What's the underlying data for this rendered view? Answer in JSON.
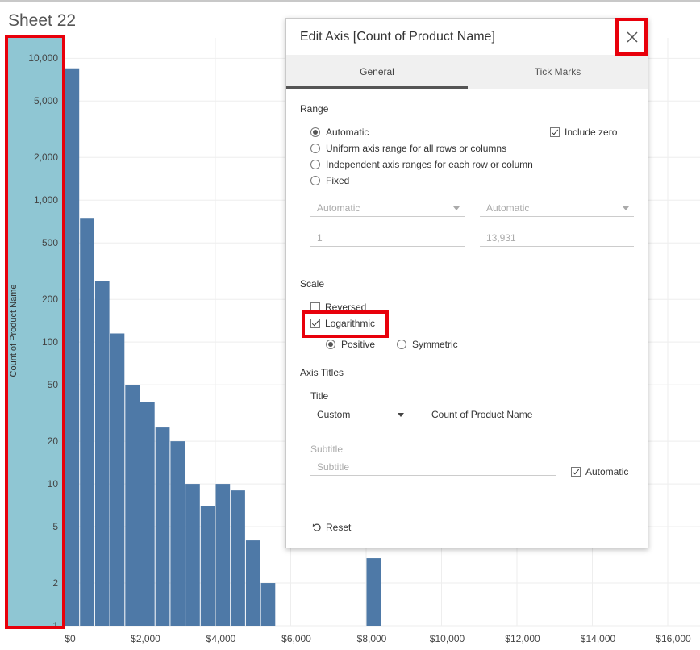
{
  "sheet_title": "Sheet 22",
  "chart_data": {
    "type": "bar",
    "ylabel": "Count of Product Name",
    "y_scale": "log",
    "y_ticks": [
      "10,000",
      "5,000",
      "2,000",
      "1,000",
      "500",
      "200",
      "100",
      "50",
      "20",
      "10",
      "5",
      "2",
      "1"
    ],
    "x_ticks": [
      "$0",
      "$2,000",
      "$4,000",
      "$6,000",
      "$8,000",
      "$10,000",
      "$12,000",
      "$14,000",
      "$16,000"
    ],
    "bin_width": 400,
    "bins": [
      {
        "x": 0,
        "value": 8500
      },
      {
        "x": 400,
        "value": 750
      },
      {
        "x": 800,
        "value": 270
      },
      {
        "x": 1200,
        "value": 115
      },
      {
        "x": 1600,
        "value": 50
      },
      {
        "x": 2000,
        "value": 38
      },
      {
        "x": 2400,
        "value": 25
      },
      {
        "x": 2800,
        "value": 20
      },
      {
        "x": 3200,
        "value": 10
      },
      {
        "x": 3600,
        "value": 7
      },
      {
        "x": 4000,
        "value": 10
      },
      {
        "x": 4400,
        "value": 9
      },
      {
        "x": 4800,
        "value": 4
      },
      {
        "x": 5200,
        "value": 2
      },
      {
        "x": 8000,
        "value": 3
      }
    ],
    "bar_color": "#4e79a7",
    "axis_pane_color": "#8fc6d3",
    "highlight_color": "#e8000b"
  },
  "dialog": {
    "title": "Edit Axis [Count of Product Name]",
    "close_icon": "close-icon",
    "tabs": [
      "General",
      "Tick Marks"
    ],
    "active_tab": "General",
    "range": {
      "label": "Range",
      "options": [
        "Automatic",
        "Uniform axis range for all rows or columns",
        "Independent axis ranges for each row or column",
        "Fixed"
      ],
      "selected": "Automatic",
      "include_zero_label": "Include zero",
      "include_zero": true,
      "start_select": "Automatic",
      "end_select": "Automatic",
      "start_value": "1",
      "end_value": "13,931"
    },
    "scale": {
      "label": "Scale",
      "reversed_label": "Reversed",
      "reversed": false,
      "log_label": "Logarithmic",
      "log": true,
      "positive_label": "Positive",
      "symmetric_label": "Symmetric",
      "selected": "Positive"
    },
    "axis_titles": {
      "label": "Axis Titles",
      "title_label": "Title",
      "title_mode": "Custom",
      "title_value": "Count of Product Name",
      "subtitle_label": "Subtitle",
      "subtitle_placeholder": "Subtitle",
      "automatic_label": "Automatic",
      "automatic": true
    },
    "reset_label": "Reset",
    "reset_icon": "undo-icon"
  }
}
